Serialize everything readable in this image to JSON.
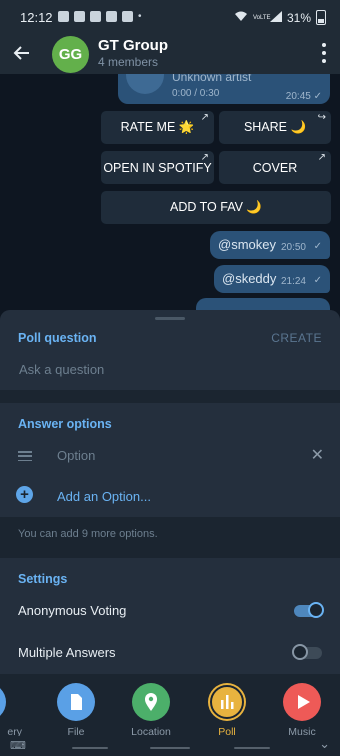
{
  "status": {
    "time": "12:12",
    "network": "VoLTE",
    "battery": "31%"
  },
  "header": {
    "avatar_initials": "GG",
    "title": "GT Group",
    "subtitle": "4 members"
  },
  "chat": {
    "audio": {
      "artist": "Unknown artist",
      "duration": "0:00 / 0:30",
      "time": "20:45"
    },
    "keyboard": {
      "rate_me": "RATE ME 🌟",
      "share": "SHARE 🌙",
      "open_spotify": "OPEN IN SPOTIFY",
      "cover": "COVER",
      "add_fav": "ADD TO FAV 🌙"
    },
    "messages": [
      {
        "text": "@smokey",
        "time": "20:50"
      },
      {
        "text": "@skeddy",
        "time": "21:24"
      }
    ]
  },
  "poll": {
    "question_title": "Poll question",
    "create_label": "CREATE",
    "question_placeholder": "Ask a question",
    "answers_title": "Answer options",
    "option_placeholder": "Option",
    "add_option": "Add an Option...",
    "remaining_note": "You can add 9 more options.",
    "settings_title": "Settings",
    "anonymous_label": "Anonymous Voting",
    "anonymous_on": true,
    "multiple_label": "Multiple Answers",
    "multiple_on": false
  },
  "attach": {
    "items": [
      {
        "label": "File",
        "color": "#5aa0e6"
      },
      {
        "label": "Location",
        "color": "#4caf6a"
      },
      {
        "label": "Poll",
        "color": "#e8b33f"
      },
      {
        "label": "Music",
        "color": "#ee5a57"
      }
    ],
    "partial_label_left": "ery"
  }
}
